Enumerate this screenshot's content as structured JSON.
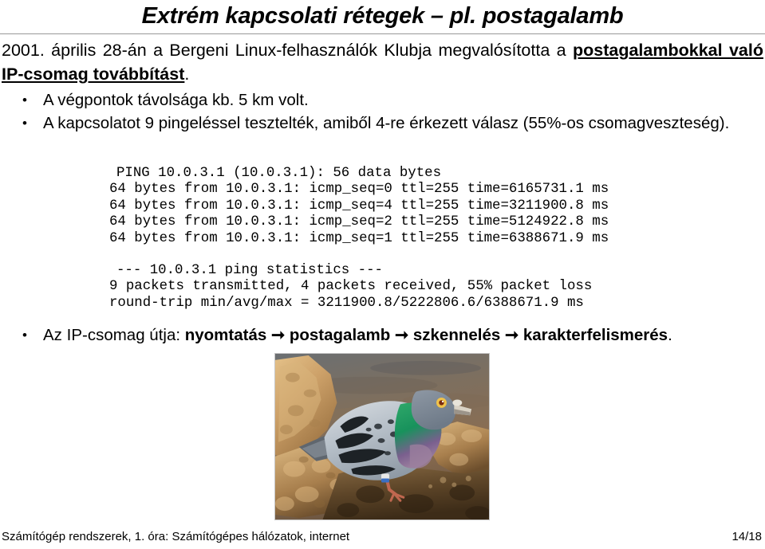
{
  "slide": {
    "title": "Extrém kapcsolati rétegek – pl. postagalamb",
    "intro": {
      "part1": "2001. április 28-án a Bergeni Linux-felhasználók Klubja megvalósította a ",
      "emphasis1": "postagalambokkal való IP-csomag továbbítást",
      "part2": "."
    },
    "bullets": [
      {
        "marker": "•",
        "text": "A végpontok távolsága kb. 5 km volt."
      },
      {
        "marker": "•",
        "text": "A kapcsolatot 9 pingeléssel tesztelték, amiből 4-re érkezett válasz (55%-os csomagveszteség)."
      },
      {
        "marker": "•",
        "prefix": "Az IP-csomag útja: ",
        "step1": "nyomtatás",
        "arrow1": " ➞ ",
        "step2": "postagalamb",
        "arrow2": " ➞ ",
        "step3": "szkennelés",
        "arrow3": " ➞ ",
        "step4": "karakterfelismerés",
        "suffix": "."
      }
    ],
    "ping_output": {
      "header": "PING 10.0.3.1 (10.0.3.1): 56 data bytes",
      "replies": [
        "64 bytes from 10.0.3.1: icmp_seq=0 ttl=255 time=6165731.1 ms",
        "64 bytes from 10.0.3.1: icmp_seq=4 ttl=255 time=3211900.8 ms",
        "64 bytes from 10.0.3.1: icmp_seq=2 ttl=255 time=5124922.8 ms",
        "64 bytes from 10.0.3.1: icmp_seq=1 ttl=255 time=6388671.9 ms"
      ],
      "stats_header": "--- 10.0.3.1 ping statistics ---",
      "stats_packets": "9 packets transmitted, 4 packets received, 55% packet loss",
      "stats_rtt": "round-trip min/avg/max = 3211900.8/5222806.6/6388671.9 ms"
    },
    "photo": {
      "alt": "postagalamb fotó"
    },
    "footer": {
      "left": "Számítógép rendszerek, 1. óra: Számítógépes hálózatok, internet",
      "page": "14/18"
    }
  }
}
